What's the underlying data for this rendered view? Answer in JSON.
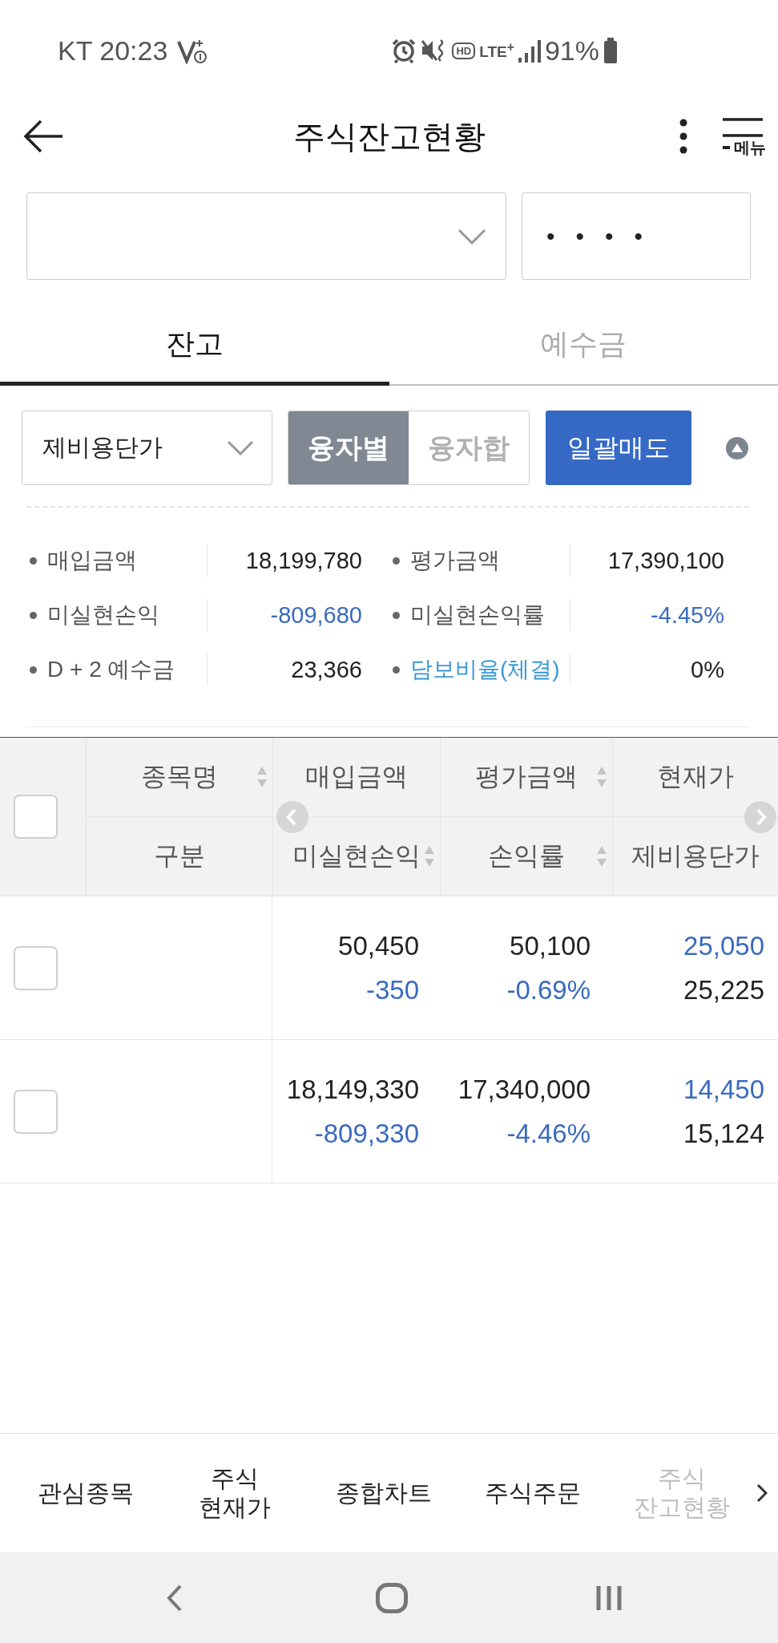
{
  "status_bar": {
    "carrier_time": "KT 20:23",
    "hd_label": "HD",
    "network_label": "LTE$^{+}$",
    "battery_text": "91%"
  },
  "header": {
    "title": "주식잔고현황",
    "menu_label": "메뉴"
  },
  "account": {
    "password_value": "••••"
  },
  "tabs": [
    {
      "label": "잔고",
      "selected": true
    },
    {
      "label": "예수금",
      "selected": false
    }
  ],
  "controls": {
    "sort_select": "제비용단가",
    "segments": [
      {
        "label": "융자별",
        "selected": true
      },
      {
        "label": "융자합",
        "selected": false
      }
    ],
    "bulk_sell_button": "일괄매도"
  },
  "summary": [
    {
      "label": "매입금액",
      "kind": "text",
      "value": "18,199,780",
      "color": "#222222"
    },
    {
      "label": "평가금액",
      "kind": "text",
      "value": "17,390,100",
      "color": "#222222"
    },
    {
      "label": "미실현손익",
      "kind": "text",
      "value": "-809,680",
      "color": "#3a6bbf"
    },
    {
      "label": "미실현손익률",
      "kind": "text",
      "value": "-4.45%",
      "color": "#3a6bbf"
    },
    {
      "label": "D + 2 예수금",
      "kind": "text",
      "value": "23,366",
      "color": "#222222"
    },
    {
      "label": "담보비율(체결)",
      "kind": "link",
      "value": "0%",
      "color": "#222222"
    }
  ],
  "table": {
    "select_all_checked": false,
    "columns": [
      {
        "top": "종목명",
        "top_sortable": true,
        "bottom": "구분",
        "bottom_sortable": false
      },
      {
        "top": "매입금액",
        "top_sortable": false,
        "bottom": "미실현손익",
        "bottom_sortable": true
      },
      {
        "top": "평가금액",
        "top_sortable": true,
        "bottom": "손익률",
        "bottom_sortable": true
      },
      {
        "top": "현재가",
        "top_sortable": false,
        "bottom": "제비용단가",
        "bottom_sortable": false
      }
    ],
    "rows": [
      {
        "checked": false,
        "cells": [
          "",
          {
            "top": {
              "text": "50,450",
              "color": "#222222"
            },
            "bottom": {
              "text": "-350",
              "color": "#3a6bbf"
            }
          },
          {
            "top": {
              "text": "50,100",
              "color": "#222222"
            },
            "bottom": {
              "text": "-0.69%",
              "color": "#3a6bbf"
            }
          },
          {
            "top": {
              "text": "25,050",
              "color": "#3a6bbf"
            },
            "bottom": {
              "text": "25,225",
              "color": "#222222"
            }
          }
        ]
      },
      {
        "checked": false,
        "cells": [
          "",
          {
            "top": {
              "text": "18,149,330",
              "color": "#222222"
            },
            "bottom": {
              "text": "-809,330",
              "color": "#3a6bbf"
            }
          },
          {
            "top": {
              "text": "17,340,000",
              "color": "#222222"
            },
            "bottom": {
              "text": "-4.46%",
              "color": "#3a6bbf"
            }
          },
          {
            "top": {
              "text": "14,450",
              "color": "#3a6bbf"
            },
            "bottom": {
              "text": "15,124",
              "color": "#222222"
            }
          }
        ]
      }
    ]
  },
  "bottom_nav": [
    {
      "label": "관심종목",
      "selected": false
    },
    {
      "label": "주식\n현재가",
      "selected": false
    },
    {
      "label": "종합차트",
      "selected": false
    },
    {
      "label": "주식주문",
      "selected": false
    },
    {
      "label": "주식\n잔고현황",
      "selected": true
    }
  ]
}
